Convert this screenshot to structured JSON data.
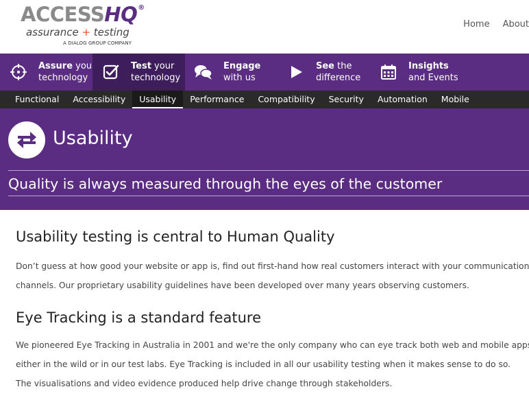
{
  "logo": {
    "brand_grey": "ACCESS",
    "brand_purple": "HQ",
    "registered": "®",
    "tagline_a": "assurance ",
    "tagline_plus": "+",
    "tagline_b": " testing",
    "sub": "A DIALOG GROUP COMPANY"
  },
  "topnav": {
    "home": "Home",
    "about": "About"
  },
  "mainnav": {
    "items": [
      {
        "bold": "Assure",
        "rest1": " your",
        "line2": "technology",
        "icon": "crosshair-icon"
      },
      {
        "bold": "Test",
        "rest1": " your",
        "line2": "technology",
        "icon": "checkbox-icon"
      },
      {
        "bold": "Engage",
        "rest1": "",
        "line2": "with us",
        "icon": "chat-bubbles-icon"
      },
      {
        "bold": "See",
        "rest1": " the",
        "line2": "difference",
        "icon": "play-icon"
      },
      {
        "bold": "Insights",
        "rest1": "",
        "line2": "and Events",
        "icon": "calendar-icon"
      }
    ]
  },
  "subnav": {
    "items": [
      "Functional",
      "Accessibility",
      "Usability",
      "Performance",
      "Compatibility",
      "Security",
      "Automation",
      "Mobile"
    ],
    "active": "Usability"
  },
  "banner": {
    "title": "Usability",
    "tagline": "Quality is always measured through the eyes of the customer",
    "icon": "swap-arrows-icon"
  },
  "content": {
    "heading1": "Usability testing is central to Human Quality",
    "para1_line1": "Don’t guess at how good your website or app is, find out first-hand how real customers interact with your communication",
    "para1_line2": "channels. Our proprietary usability guidelines have been developed over many years observing customers.",
    "heading2": "Eye Tracking is a standard feature",
    "para2_line1": "We pioneered Eye Tracking in Australia in 2001 and we're the only company who can eye track both web and mobile apps,",
    "para2_line2": "either in the wild or in our test labs. Eye Tracking is included in all our usability testing when it makes sense to do so.",
    "para2_line3": "The visualisations and video evidence produced help drive change through stakeholders."
  },
  "colors": {
    "purple": "#5b2d82",
    "purple_dark": "#3e1d5c",
    "subnav_bg": "#2a2a2a",
    "accent_orange": "#e8531e"
  }
}
